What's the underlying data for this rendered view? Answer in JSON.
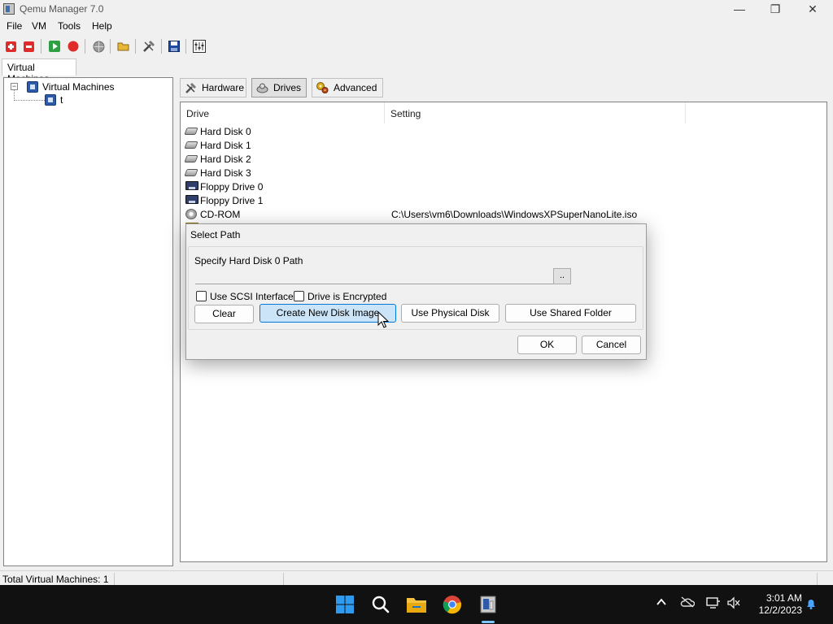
{
  "window": {
    "title": "Qemu Manager 7.0",
    "controls": {
      "minimize": "—",
      "maximize": "❐",
      "close": "✕"
    }
  },
  "menu": [
    "File",
    "VM",
    "Tools",
    "Help"
  ],
  "toolbar": {
    "icons": [
      "add-vm-icon",
      "remove-vm-icon",
      "start-vm-icon",
      "stop-vm-icon",
      "globe-icon",
      "open-folder-icon",
      "tools-icon",
      "save-icon",
      "settings-icon"
    ]
  },
  "left_panel": {
    "tab_label": "Virtual Machines",
    "tree": {
      "root": "Virtual Machines",
      "expander": "−",
      "child": "t"
    }
  },
  "config_tabs": [
    "Hardware",
    "Drives",
    "Advanced"
  ],
  "drives": {
    "columns": [
      "Drive",
      "Setting"
    ],
    "rows": [
      {
        "icon": "hard-disk-icon",
        "drive": "Hard Disk 0",
        "setting": ""
      },
      {
        "icon": "hard-disk-icon",
        "drive": "Hard Disk 1",
        "setting": ""
      },
      {
        "icon": "hard-disk-icon",
        "drive": "Hard Disk 2",
        "setting": ""
      },
      {
        "icon": "hard-disk-icon",
        "drive": "Hard Disk 3",
        "setting": ""
      },
      {
        "icon": "floppy-icon",
        "drive": "Floppy Drive 0",
        "setting": ""
      },
      {
        "icon": "floppy-icon",
        "drive": "Floppy Drive 1",
        "setting": ""
      },
      {
        "icon": "cd-rom-icon",
        "drive": "CD-ROM",
        "setting": "C:\\Users\\vm6\\Downloads\\WindowsXPSuperNanoLite.iso"
      }
    ]
  },
  "dialog": {
    "title": "Select Path",
    "path_label": "Specify Hard Disk 0 Path",
    "path_value": "",
    "browse_label": "..",
    "checkbox_scsi": "Use SCSI Interface",
    "checkbox_encrypted": "Drive is Encrypted",
    "btn_clear": "Clear",
    "btn_create": "Create New Disk Image",
    "btn_physical": "Use Physical Disk",
    "btn_shared": "Use Shared Folder",
    "btn_ok": "OK",
    "btn_cancel": "Cancel"
  },
  "status": {
    "text": "Total Virtual Machines: 1"
  },
  "taskbar": {
    "time": "3:01 AM",
    "date": "12/2/2023",
    "icons": [
      "start-icon",
      "search-icon",
      "file-explorer-icon",
      "chrome-icon",
      "qemu-manager-icon"
    ]
  }
}
